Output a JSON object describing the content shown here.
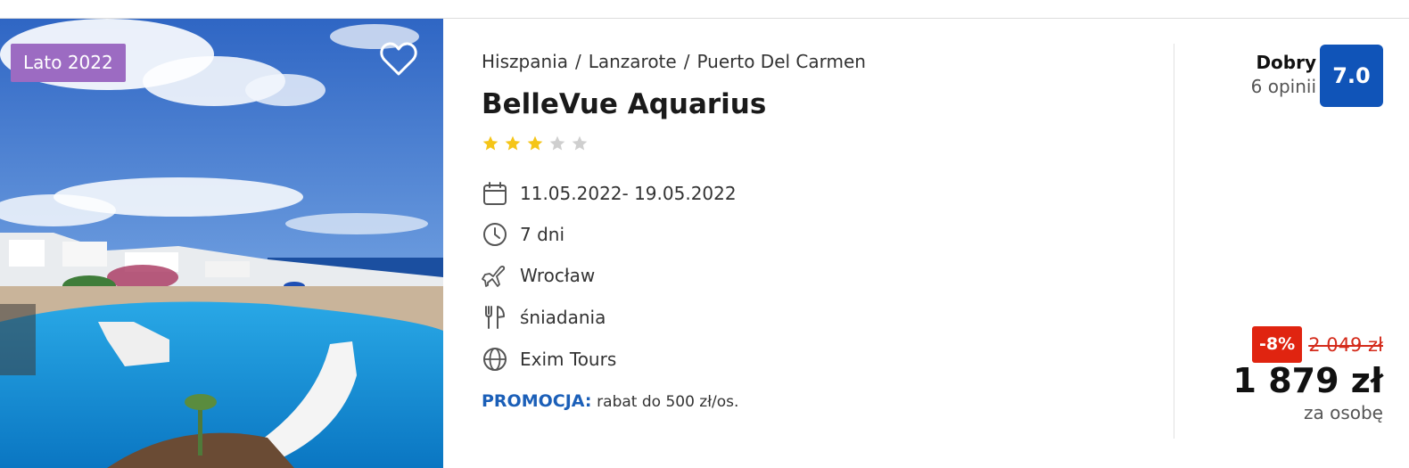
{
  "offer": {
    "season_badge": "Lato 2022",
    "favorite_icon": "heart-outline-icon",
    "breadcrumb": [
      "Hiszpania",
      "Lanzarote",
      "Puerto Del Carmen"
    ],
    "breadcrumb_separator": "/",
    "hotel_name": "BelleVue Aquarius",
    "stars": {
      "rating": 3,
      "max": 5,
      "filled_color": "#f5c518",
      "empty_color": "#cfcfcf"
    },
    "features": [
      {
        "icon": "calendar-icon",
        "text": "11.05.2022- 19.05.2022"
      },
      {
        "icon": "clock-icon",
        "text": "7 dni"
      },
      {
        "icon": "airplane-icon",
        "text": "Wrocław"
      },
      {
        "icon": "cutlery-icon",
        "text": "śniadania"
      },
      {
        "icon": "globe-icon",
        "text": "Exim Tours"
      }
    ],
    "promo": {
      "label": "PROMOCJA:",
      "text": "rabat do 500 zł/os."
    },
    "rating": {
      "label": "Dobry",
      "count": "6 opinii",
      "score": "7.0"
    },
    "pricing": {
      "discount": "-8%",
      "old_price": "2 049 zł",
      "price": "1 879 zł",
      "per_person": "za osobę"
    }
  },
  "colors": {
    "season_badge": "#9c6bc2",
    "score_badge": "#1054b8",
    "promo_label": "#1b5fb8",
    "discount_badge": "#e02410",
    "old_price": "#d42a1a"
  }
}
